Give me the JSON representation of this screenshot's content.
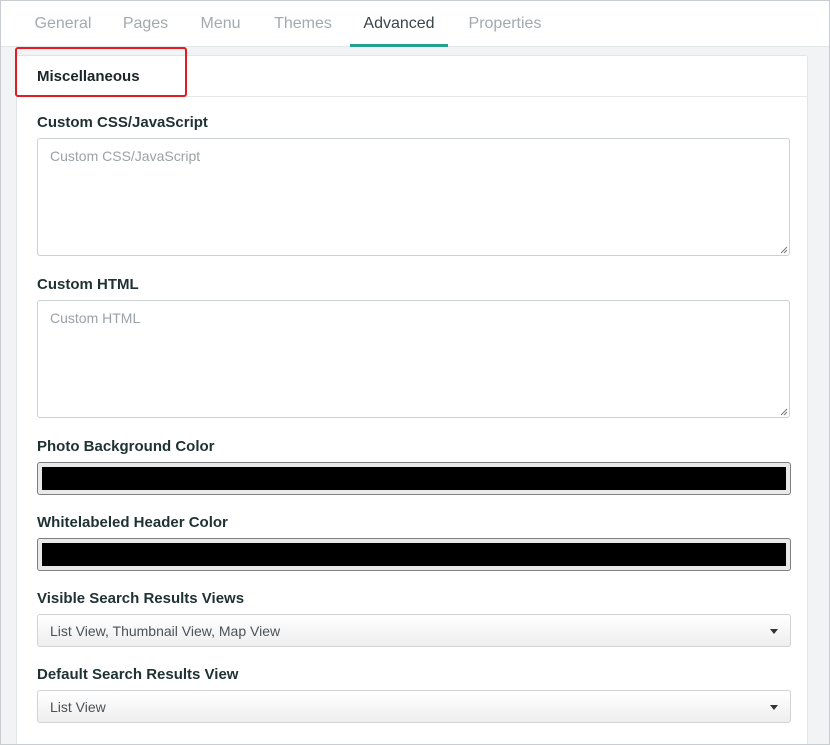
{
  "tabs": [
    {
      "label": "General"
    },
    {
      "label": "Pages"
    },
    {
      "label": "Menu"
    },
    {
      "label": "Themes"
    },
    {
      "label": "Advanced"
    },
    {
      "label": "Properties"
    }
  ],
  "active_tab": "Advanced",
  "section": {
    "title": "Miscellaneous"
  },
  "fields": {
    "custom_css": {
      "label": "Custom CSS/JavaScript",
      "placeholder": "Custom CSS/JavaScript",
      "value": ""
    },
    "custom_html": {
      "label": "Custom HTML",
      "placeholder": "Custom HTML",
      "value": ""
    },
    "photo_bg_color": {
      "label": "Photo Background Color",
      "value": "#000000"
    },
    "header_color": {
      "label": "Whitelabeled Header Color",
      "value": "#000000"
    },
    "visible_views": {
      "label": "Visible Search Results Views",
      "value": "List View, Thumbnail View, Map View"
    },
    "default_view": {
      "label": "Default Search Results View",
      "value": "List View"
    }
  },
  "colors": {
    "accent": "#26a08f",
    "highlight": "#e31b23"
  }
}
